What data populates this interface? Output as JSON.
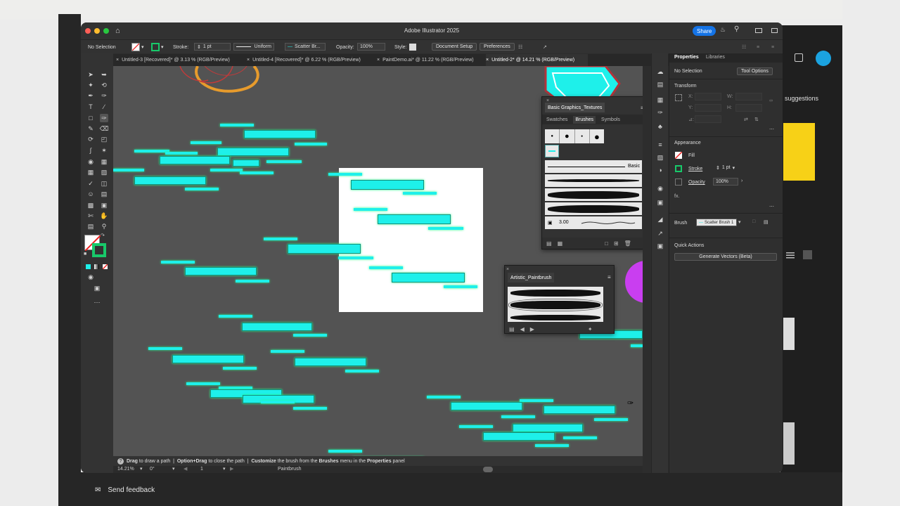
{
  "window": {
    "title": "Adobe Illustrator 2025",
    "share_label": "Share"
  },
  "control_bar": {
    "selection": "No Selection",
    "stroke_label": "Stroke:",
    "stroke_value": "1 pt",
    "profile": "Uniform",
    "brush": "Scatter Br...",
    "opacity_label": "Opacity:",
    "opacity_value": "100%",
    "style_label": "Style:",
    "document_setup": "Document Setup",
    "preferences": "Preferences"
  },
  "tabs": [
    {
      "label": "Untitled-3 [Recovered]* @ 3.13 % (RGB/Preview)"
    },
    {
      "label": "Untitled-4 [Recovered]* @ 6.22 % (RGB/Preview)"
    },
    {
      "label": "PaintDemo.ai* @ 11.22 % (RGB/Preview)"
    },
    {
      "label": "Untitled-2* @ 14.21 % (RGB/Preview)"
    }
  ],
  "brushes_panel": {
    "group_title": "Basic Graphics_Textures",
    "tabs": [
      "Swatches",
      "Brushes",
      "Symbols"
    ],
    "basic_label": "Basic",
    "size_value": "3.00"
  },
  "artistic_panel": {
    "title": "Artistic_Paintbrush"
  },
  "properties": {
    "tabs": [
      "Properties",
      "Libraries"
    ],
    "no_selection": "No Selection",
    "tool_options": "Tool Options",
    "transform_title": "Transform",
    "x_label": "X:",
    "y_label": "Y:",
    "w_label": "W:",
    "h_label": "H:",
    "angle_label": "⊿:",
    "appearance_title": "Appearance",
    "fill_label": "Fill",
    "stroke_label": "Stroke",
    "stroke_value": "1 pt",
    "opacity_label": "Opacity",
    "opacity_value": "100%",
    "fx_label": "fx.",
    "brush_label": "Brush",
    "brush_value": "Scatter Brush 1",
    "quick_actions_title": "Quick Actions",
    "generate_vectors": "Generate Vectors (Beta)"
  },
  "status": {
    "hint_drag": "Drag",
    "hint_1": " to draw a path  |  ",
    "hint_option_drag": "Option+Drag",
    "hint_2": " to close the path  |  ",
    "hint_customize": "Customize",
    "hint_3": " the brush from the ",
    "hint_brushes": "Brushes",
    "hint_4": " menu in the ",
    "hint_properties": "Properties",
    "hint_5": " panel"
  },
  "bottom_bar": {
    "zoom": "14.21%",
    "rotation": "0°",
    "artboard": "1",
    "tool": "Paintbrush"
  },
  "background": {
    "feedback": "Send feedback",
    "suggestions": "suggestions"
  },
  "colors": {
    "cyan_stroke": "#1ef0ea",
    "green_glow": "#20ff8a",
    "accent_blue": "#1473e6",
    "yellow_card": "#f7d117"
  }
}
